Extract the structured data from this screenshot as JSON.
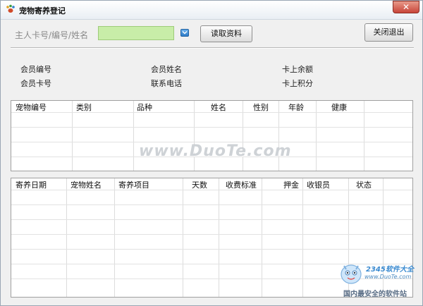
{
  "window": {
    "title": "宠物寄养登记",
    "close_glyph": "✕"
  },
  "search": {
    "owner_label": "主人卡号/编号/姓名",
    "owner_value": "",
    "read_button": "读取资料",
    "exit_button": "关闭退出"
  },
  "member_info": {
    "member_no": "会员编号",
    "member_name": "会员姓名",
    "card_balance": "卡上余额",
    "card_no": "会员卡号",
    "phone": "联系电话",
    "card_points": "卡上积分"
  },
  "pet_table": {
    "columns": [
      "宠物编号",
      "类别",
      "品种",
      "姓名",
      "性别",
      "年龄",
      "健康"
    ]
  },
  "boarding_table": {
    "columns": [
      "寄养日期",
      "宠物姓名",
      "寄养项目",
      "天数",
      "收费标准",
      "押金",
      "收银员",
      "状态"
    ]
  },
  "watermark": {
    "text": "www.DuoTe.com"
  },
  "corner_logo": {
    "text": "2345软件大全",
    "url": "www.DuoTe.com",
    "slogan": "国内最安全的软件站"
  },
  "icons": {
    "app": "paw-icon",
    "dropdown": "chevron-down-icon",
    "close": "close-icon"
  }
}
